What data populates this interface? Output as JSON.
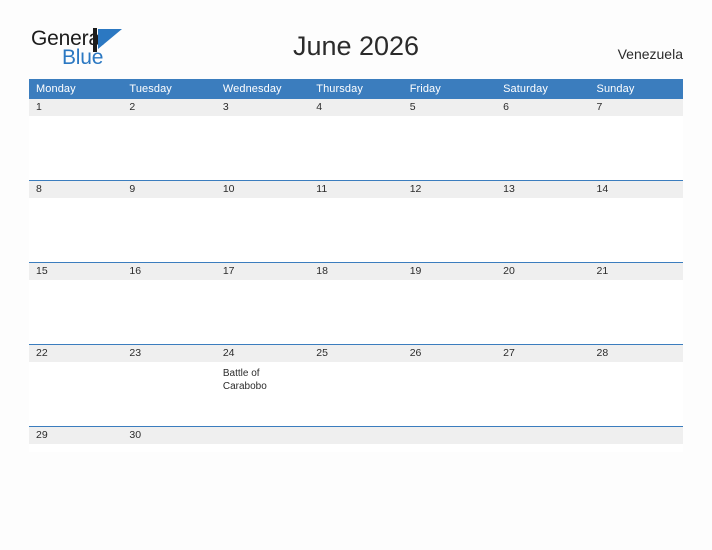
{
  "brand": {
    "name_part1": "General",
    "name_part2": "Blue",
    "mark": "blue-triangle-flag-icon",
    "accent_color": "#2b78c2"
  },
  "header": {
    "title": "June 2026",
    "country": "Venezuela"
  },
  "colors": {
    "header_blue": "#3b7dbe",
    "daynum_band": "#efefef",
    "page_background": "#fdfdfd",
    "text": "#2b2b2b"
  },
  "calendar": {
    "weekday_headers": [
      "Monday",
      "Tuesday",
      "Wednesday",
      "Thursday",
      "Friday",
      "Saturday",
      "Sunday"
    ],
    "weeks": [
      [
        {
          "day": "1",
          "events": []
        },
        {
          "day": "2",
          "events": []
        },
        {
          "day": "3",
          "events": []
        },
        {
          "day": "4",
          "events": []
        },
        {
          "day": "5",
          "events": []
        },
        {
          "day": "6",
          "events": []
        },
        {
          "day": "7",
          "events": []
        }
      ],
      [
        {
          "day": "8",
          "events": []
        },
        {
          "day": "9",
          "events": []
        },
        {
          "day": "10",
          "events": []
        },
        {
          "day": "11",
          "events": []
        },
        {
          "day": "12",
          "events": []
        },
        {
          "day": "13",
          "events": []
        },
        {
          "day": "14",
          "events": []
        }
      ],
      [
        {
          "day": "15",
          "events": []
        },
        {
          "day": "16",
          "events": []
        },
        {
          "day": "17",
          "events": []
        },
        {
          "day": "18",
          "events": []
        },
        {
          "day": "19",
          "events": []
        },
        {
          "day": "20",
          "events": []
        },
        {
          "day": "21",
          "events": []
        }
      ],
      [
        {
          "day": "22",
          "events": []
        },
        {
          "day": "23",
          "events": []
        },
        {
          "day": "24",
          "events": [
            "Battle of Carabobo"
          ]
        },
        {
          "day": "25",
          "events": []
        },
        {
          "day": "26",
          "events": []
        },
        {
          "day": "27",
          "events": []
        },
        {
          "day": "28",
          "events": []
        }
      ],
      [
        {
          "day": "29",
          "events": []
        },
        {
          "day": "30",
          "events": []
        },
        {
          "day": "",
          "events": []
        },
        {
          "day": "",
          "events": []
        },
        {
          "day": "",
          "events": []
        },
        {
          "day": "",
          "events": []
        },
        {
          "day": "",
          "events": []
        }
      ]
    ]
  }
}
